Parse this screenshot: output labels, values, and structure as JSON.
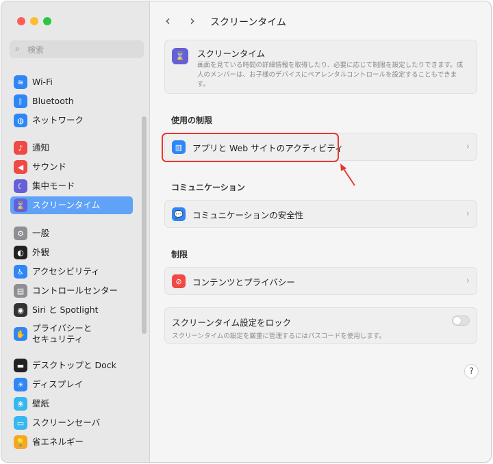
{
  "sidebar": {
    "search_placeholder": "検索",
    "items": [
      {
        "label": "Wi-Fi",
        "icon": "wifi-icon",
        "color": "#2f87f5",
        "glyph": "≋"
      },
      {
        "label": "Bluetooth",
        "icon": "bluetooth-icon",
        "color": "#2f87f5",
        "glyph": "ᛒ"
      },
      {
        "label": "ネットワーク",
        "icon": "globe-icon",
        "color": "#2f87f5",
        "glyph": "◍"
      },
      {
        "label": "通知",
        "icon": "bell-icon",
        "color": "#ef4a45",
        "glyph": "♪"
      },
      {
        "label": "サウンド",
        "icon": "speaker-icon",
        "color": "#ef4a45",
        "glyph": "◀"
      },
      {
        "label": "集中モード",
        "icon": "moon-icon",
        "color": "#6560d8",
        "glyph": "☾"
      },
      {
        "label": "スクリーンタイム",
        "icon": "hourglass-icon",
        "color": "#6560d8",
        "glyph": "⌛"
      },
      {
        "label": "一般",
        "icon": "gear-icon",
        "color": "#8e8e93",
        "glyph": "⚙"
      },
      {
        "label": "外観",
        "icon": "appearance-icon",
        "color": "#222",
        "glyph": "◐"
      },
      {
        "label": "アクセシビリティ",
        "icon": "accessibility-icon",
        "color": "#2f87f5",
        "glyph": "♿"
      },
      {
        "label": "コントロールセンター",
        "icon": "control-center-icon",
        "color": "#8e8e93",
        "glyph": "▤"
      },
      {
        "label": "Siri と Spotlight",
        "icon": "siri-icon",
        "color": "#333",
        "glyph": "◉"
      },
      {
        "label": "プライバシーと\nセキュリティ",
        "icon": "hand-icon",
        "color": "#2f87f5",
        "glyph": "✋"
      },
      {
        "label": "デスクトップと Dock",
        "icon": "dock-icon",
        "color": "#222",
        "glyph": "▬"
      },
      {
        "label": "ディスプレイ",
        "icon": "display-icon",
        "color": "#2f87f5",
        "glyph": "☀"
      },
      {
        "label": "壁紙",
        "icon": "wallpaper-icon",
        "color": "#38b6f0",
        "glyph": "❀"
      },
      {
        "label": "スクリーンセーバ",
        "icon": "screensaver-icon",
        "color": "#38b6f0",
        "glyph": "▭"
      },
      {
        "label": "省エネルギー",
        "icon": "lightbulb-icon",
        "color": "#f5a623",
        "glyph": "💡"
      }
    ]
  },
  "header": {
    "title": "スクリーンタイム",
    "back": "‹",
    "forward": "›"
  },
  "intro": {
    "title": "スクリーンタイム",
    "description": "画面を見ている時間の詳細情報を取得したり、必要に応じて制限を設定したりできます。成人のメンバーは、お子様のデバイスにペアレンタルコントロールを設定することもできます。"
  },
  "sections": [
    {
      "label": "使用の制限",
      "row": "アプリと Web サイトのアクティビティ",
      "color": "#2f87f5",
      "glyph": "▥"
    },
    {
      "label": "コミュニケーション",
      "row": "コミュニケーションの安全性",
      "color": "#2f87f5",
      "glyph": "💬"
    },
    {
      "label": "制限",
      "row": "コンテンツとプライバシー",
      "color": "#ef4a45",
      "glyph": "⊘"
    }
  ],
  "lock": {
    "title": "スクリーンタイム設定をロック",
    "subtitle": "スクリーンタイムの設定を厳重に管理するにはパスコードを使用します。",
    "enabled": false
  },
  "help": "?"
}
